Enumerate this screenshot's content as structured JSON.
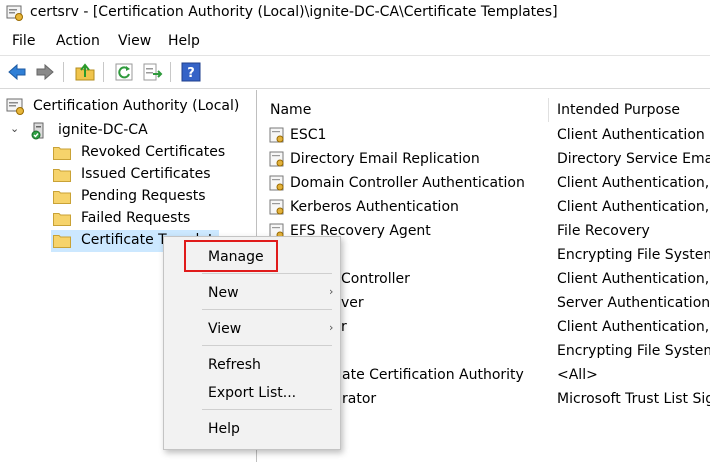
{
  "window": {
    "title": "certsrv - [Certification Authority (Local)\\ignite-DC-CA\\Certificate Templates]"
  },
  "menu": [
    "File",
    "Action",
    "View",
    "Help"
  ],
  "toolbar": {
    "buttons": [
      "back-arrow-icon",
      "forward-arrow-icon",
      "up-folder-icon",
      "refresh-icon",
      "export-list-icon",
      "help-icon"
    ]
  },
  "tree": {
    "root": "Certification Authority (Local)",
    "ca": "ignite-DC-CA",
    "folders": [
      "Revoked Certificates",
      "Issued Certificates",
      "Pending Requests",
      "Failed Requests",
      "Certificate Templates"
    ]
  },
  "list": {
    "headers": {
      "name": "Name",
      "purpose": "Intended Purpose"
    },
    "rows": [
      {
        "name": "ESC1",
        "purpose": "Client Authentication"
      },
      {
        "name": "Directory Email Replication",
        "purpose": "Directory Service Email Replication"
      },
      {
        "name": "Domain Controller Authentication",
        "purpose": "Client Authentication, Server Authentication"
      },
      {
        "name": "Kerberos Authentication",
        "purpose": "Client Authentication, Server Authentication"
      },
      {
        "name": "EFS Recovery Agent",
        "purpose": "File Recovery"
      },
      {
        "name": "",
        "purpose": "Encrypting File System"
      },
      {
        "name": "Controller",
        "purpose": "Client Authentication, Server Authentication"
      },
      {
        "name": "ver",
        "purpose": "Server Authentication"
      },
      {
        "name": "r",
        "purpose": "Client Authentication, Secure Email"
      },
      {
        "name": "",
        "purpose": "Encrypting File System, Secure Email"
      },
      {
        "name": "ate Certification Authority",
        "purpose": "<All>"
      },
      {
        "name": "rator",
        "purpose": "Microsoft Trust List Signing"
      }
    ]
  },
  "context_menu": {
    "manage": "Manage",
    "new": "New",
    "view": "View",
    "refresh": "Refresh",
    "export_list": "Export List...",
    "help": "Help",
    "submenu_arrow": "›"
  },
  "colors": {
    "selection": "#cce8ff",
    "highlight_box": "#e01b1b",
    "folder": "#f6d36b"
  }
}
